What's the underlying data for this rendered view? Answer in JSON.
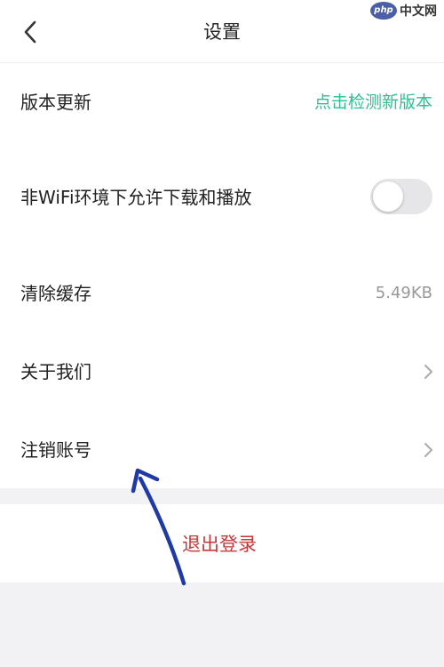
{
  "header": {
    "title": "设置",
    "back_icon": "chevron-left-icon"
  },
  "watermark": {
    "logo_text": "php",
    "text": "中文网"
  },
  "settings": {
    "version_update": {
      "label": "版本更新",
      "action": "点击检测新版本"
    },
    "wifi_download": {
      "label": "非WiFi环境下允许下载和播放",
      "enabled": false
    },
    "clear_cache": {
      "label": "清除缓存",
      "value": "5.49KB"
    },
    "about_us": {
      "label": "关于我们"
    },
    "cancel_account": {
      "label": "注销账号"
    }
  },
  "logout": {
    "label": "退出登录"
  },
  "colors": {
    "accent_green": "#2bbf92",
    "logout_red": "#c23a3a",
    "annotation_arrow": "#1f3aa6"
  }
}
